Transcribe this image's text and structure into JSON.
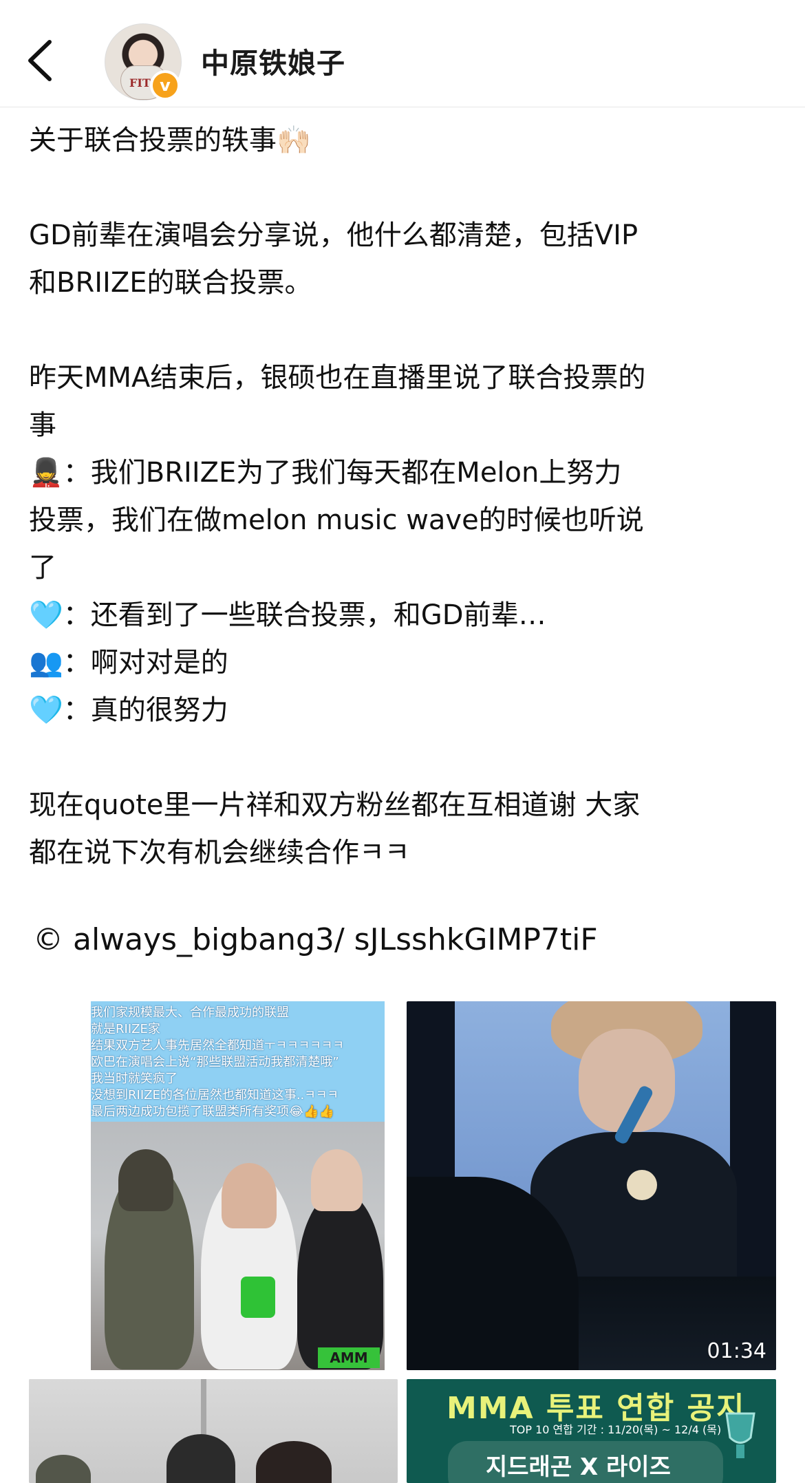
{
  "header": {
    "username": "中原铁娘子",
    "verified_mark": "v",
    "avatar_shirt_text": "FITC"
  },
  "post": {
    "lines": [
      "关于联合投票的轶事🙌🏻",
      "",
      "GD前辈在演唱会分享说，他什么都清楚，包括VIP",
      "和BRIIZE的联合投票。",
      "",
      "昨天MMA结束后，银硕也在直播里说了联合投票的",
      "事",
      "💂：我们BRIIZE为了我们每天都在Melon上努力",
      "投票，我们在做melon music  wave的时候也听说",
      "了",
      "🩵：还看到了一些联合投票，和GD前辈…",
      "👥：啊对对是的",
      "🩵：真的很努力",
      "",
      "现在quote里一片祥和双方粉丝都在互相道谢 大家",
      "都在说下次有机会继续合作ㅋㅋ"
    ],
    "source": "© always_bigbang3/ sJLsshkGIMP7tiF"
  },
  "media": {
    "tile1_lines": [
      "我们家规模最大、合作最成功的联盟",
      "就是RIIZE家",
      "结果双方艺人事先居然全都知道ㅜㅋㅋㅋㅋㅋㅋ",
      "欧巴在演唱会上说“那些联盟活动我都清楚哦”",
      "我当时就笑疯了",
      "没想到RIIZE的各位居然也都知道这事..ㅋㅋㅋ",
      "最后两边成功包揽了联盟类所有奖项😂👍👍"
    ],
    "tile1_sign": "AMM",
    "tile2_duration": "01:34",
    "tile4_title": "MMA 투표 연합 공지",
    "tile4_sub": "TOP 10 연합 기간 : 11/20(목) ~ 12/4 (목)",
    "tile4_names": "지드래곤 X 라이즈"
  }
}
